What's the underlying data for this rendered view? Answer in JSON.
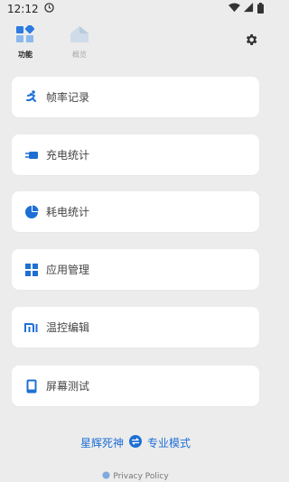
{
  "status_bar": {
    "time": "12:12"
  },
  "nav": {
    "tabs": [
      {
        "label": "功能"
      },
      {
        "label": "概览"
      }
    ]
  },
  "menu": {
    "items": [
      {
        "label": "帧率记录",
        "icon": "running-icon"
      },
      {
        "label": "充电统计",
        "icon": "charger-icon"
      },
      {
        "label": "耗电统计",
        "icon": "pie-chart-icon"
      },
      {
        "label": "应用管理",
        "icon": "apps-grid-icon"
      },
      {
        "label": "温控编辑",
        "icon": "mi-logo-icon"
      },
      {
        "label": "屏幕测试",
        "icon": "phone-screen-icon"
      }
    ]
  },
  "footer": {
    "left_link": "星辉死神",
    "right_link": "专业模式",
    "privacy": "Privacy Policy"
  },
  "colors": {
    "accent": "#1e6fd4",
    "background": "#ececec",
    "card": "#ffffff"
  }
}
